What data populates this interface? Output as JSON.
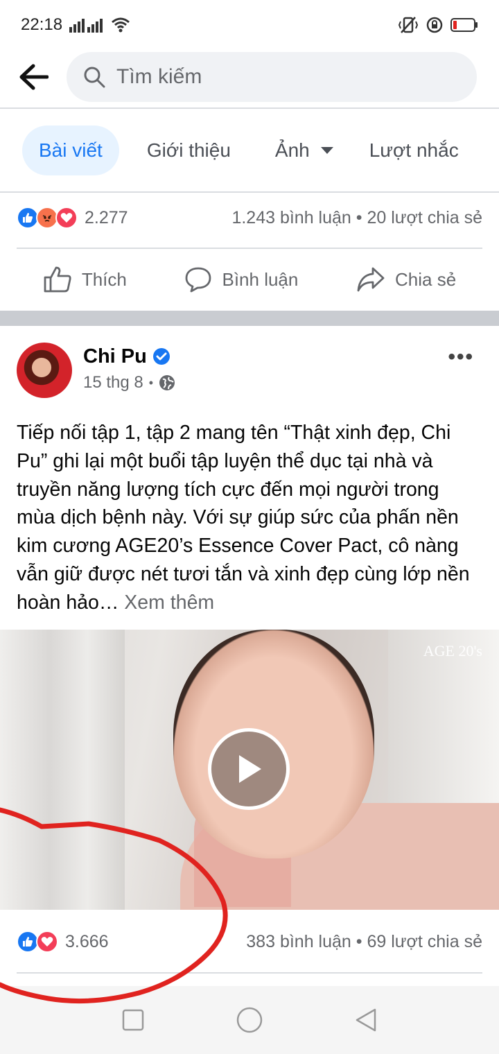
{
  "status_bar": {
    "time": "22:18"
  },
  "search": {
    "placeholder": "Tìm kiếm"
  },
  "tabs": [
    {
      "label": "Bài viết",
      "active": true
    },
    {
      "label": "Giới thiệu"
    },
    {
      "label": "Ảnh"
    },
    {
      "label": "Lượt nhắc"
    }
  ],
  "prev_post": {
    "reaction_count": "2.277",
    "stats": "1.243 bình luận • 20 lượt chia sẻ",
    "actions": {
      "like": "Thích",
      "comment": "Bình luận",
      "share": "Chia sẻ"
    }
  },
  "post": {
    "author": "Chi Pu",
    "date": "15 thg 8",
    "text": "Tiếp nối tập 1, tập 2 mang tên “Thật xinh đẹp, Chi Pu” ghi lại một buổi tập luyện thể dục tại nhà và truyền năng lượng tích cực đến mọi người trong mùa dịch bệnh này. Với sự giúp sức của phấn nền kim cương AGE20’s Essence Cover Pact, cô nàng vẫn giữ được nét tươi tắn và xinh đẹp cùng lớp nền hoàn hảo…",
    "see_more": "Xem thêm",
    "video_watermark": "AGE 20's",
    "reaction_count": "3.666",
    "stats": "383 bình luận • 69 lượt chia sẻ"
  },
  "colors": {
    "facebook_blue": "#1877f2",
    "love_red": "#f33e58",
    "angry_orange": "#f7714c",
    "annotation_red": "#e0231f"
  }
}
